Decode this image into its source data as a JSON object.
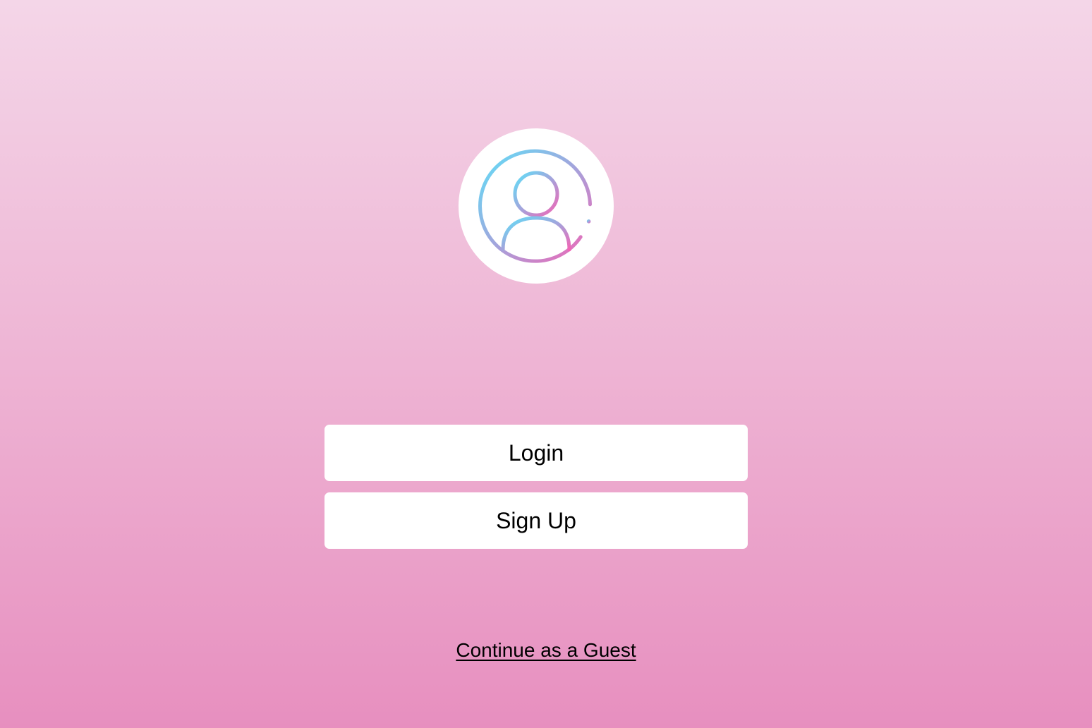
{
  "avatar": {
    "icon": "user-avatar-icon",
    "gradient_start": "#6dd6f5",
    "gradient_end": "#f06bb8"
  },
  "buttons": {
    "login_label": "Login",
    "signup_label": "Sign Up"
  },
  "guest": {
    "link_label": "Continue as a Guest"
  },
  "colors": {
    "background_top": "#f4d6e8",
    "background_bottom": "#e78fbf",
    "button_bg": "#ffffff",
    "text": "#000000"
  }
}
